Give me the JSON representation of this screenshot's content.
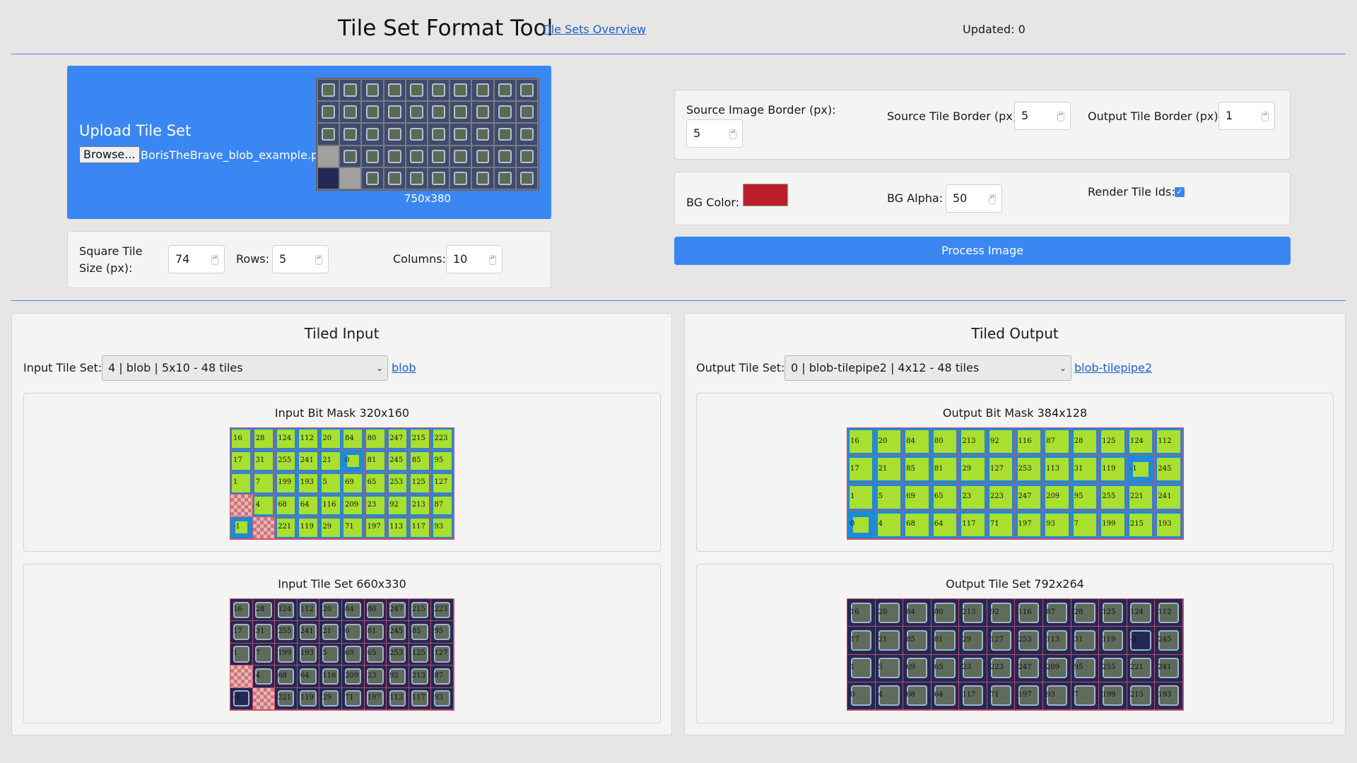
{
  "header": {
    "title": "Tile Set Format Tool",
    "overview_link": "Tile Sets Overview",
    "updated": "Updated: 0"
  },
  "upload": {
    "title": "Upload Tile Set",
    "browse_label": "Browse...",
    "filename": "BorisTheBrave_blob_example.png",
    "image_size": "750x380"
  },
  "tile_size": {
    "square_label": "Square Tile Size (px):",
    "square_value": "74",
    "rows_label": "Rows:",
    "rows_value": "5",
    "columns_label": "Columns:",
    "columns_value": "10"
  },
  "borders": {
    "source_image_label": "Source Image Border (px):",
    "source_image_value": "5",
    "source_tile_label": "Source Tile Border (px):",
    "source_tile_value": "5",
    "output_tile_label": "Output Tile Border (px):",
    "output_tile_value": "1"
  },
  "bg": {
    "color_label": "BG Color:",
    "color_value": "#bb1e2b",
    "alpha_label": "BG Alpha:",
    "alpha_value": "50",
    "render_ids_label": "Render Tile Ids:",
    "render_ids_checked": true
  },
  "process_button": "Process Image",
  "tiled_input": {
    "title": "Tiled Input",
    "select_label": "Input Tile Set:",
    "select_value": "4 | blob | 5x10 - 48 tiles",
    "link": "blob",
    "mask_title": "Input Bit Mask 320x160",
    "tileset_title": "Input Tile Set 660x330",
    "tile_ids": [
      [
        "16",
        "28",
        "124",
        "112",
        "20",
        "84",
        "80",
        "247",
        "215",
        "223"
      ],
      [
        "17",
        "31",
        "255",
        "241",
        "21",
        "0",
        "81",
        "245",
        "85",
        "95"
      ],
      [
        "1",
        "7",
        "199",
        "193",
        "5",
        "69",
        "65",
        "253",
        "125",
        "127"
      ],
      [
        "",
        "4",
        "68",
        "64",
        "116",
        "209",
        "23",
        "92",
        "213",
        "87"
      ],
      [
        "-1",
        "",
        "221",
        "119",
        "29",
        "71",
        "197",
        "113",
        "117",
        "93"
      ]
    ]
  },
  "tiled_output": {
    "title": "Tiled Output",
    "select_label": "Output Tile Set:",
    "select_value": "0 | blob-tilepipe2 | 4x12 - 48 tiles",
    "link": "blob-tilepipe2",
    "mask_title": "Output Bit Mask 384x128",
    "tileset_title": "Output Tile Set 792x264",
    "tile_ids": [
      [
        "16",
        "20",
        "84",
        "80",
        "213",
        "92",
        "116",
        "87",
        "28",
        "125",
        "124",
        "112"
      ],
      [
        "17",
        "21",
        "85",
        "81",
        "29",
        "127",
        "253",
        "113",
        "31",
        "119",
        "-1",
        "245"
      ],
      [
        "1",
        "5",
        "69",
        "65",
        "23",
        "223",
        "247",
        "209",
        "95",
        "255",
        "221",
        "241"
      ],
      [
        "0",
        "4",
        "68",
        "64",
        "117",
        "71",
        "197",
        "93",
        "7",
        "199",
        "215",
        "193"
      ]
    ]
  },
  "icons": {
    "spinner": "spinner-icon",
    "chevron": "chevron-down-icon",
    "checkmark": "checkmark-icon"
  }
}
